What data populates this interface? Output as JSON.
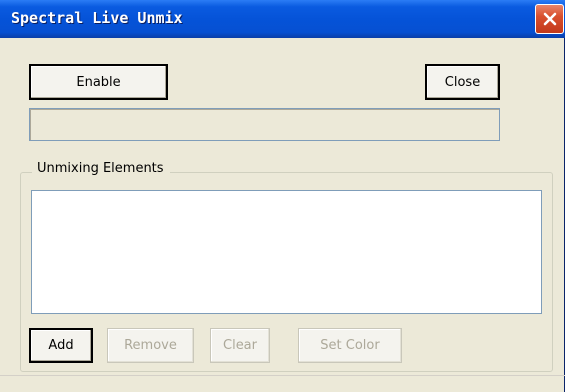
{
  "window": {
    "title": "Spectral Live Unmix"
  },
  "controls": {
    "enable_label": "Enable",
    "close_label": "Close"
  },
  "group": {
    "legend": "Unmixing Elements",
    "items": []
  },
  "buttons": {
    "add": "Add",
    "remove": "Remove",
    "clear": "Clear",
    "set_color": "Set Color"
  },
  "colors": {
    "titlebar": "#0553d8",
    "close_button": "#d9502e",
    "window_bg": "#ece9d8",
    "disabled_text": "#aca899"
  }
}
